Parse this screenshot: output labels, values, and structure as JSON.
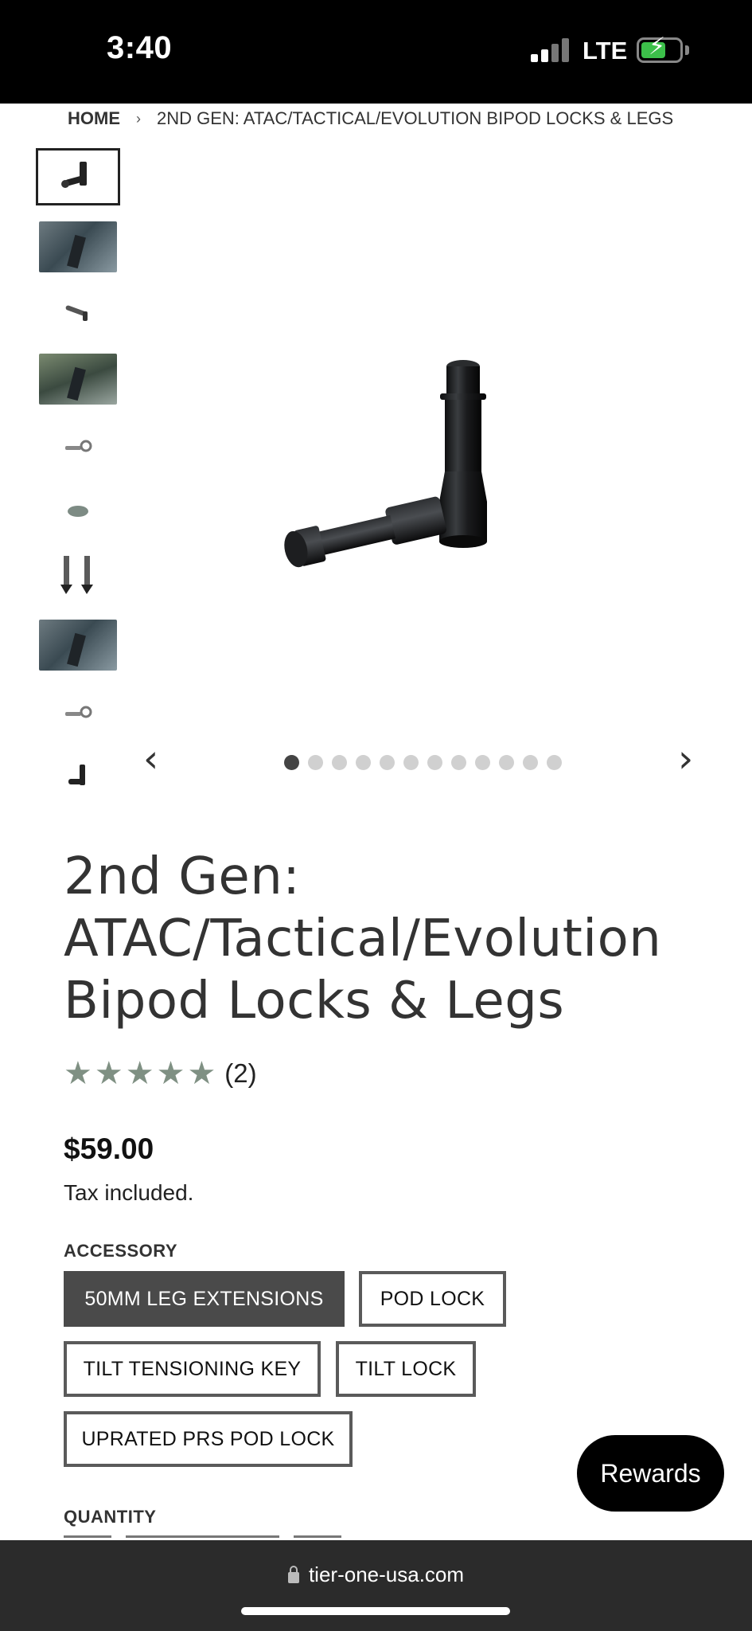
{
  "status_bar": {
    "time": "3:40",
    "network": "LTE",
    "icons": [
      "signal-icon",
      "battery-charging-icon"
    ]
  },
  "breadcrumb": {
    "home": "HOME",
    "separator": "›",
    "current": "2ND GEN: ATAC/TACTICAL/EVOLUTION BIPOD LOCKS & LEGS"
  },
  "gallery": {
    "thumbnail_count": 10,
    "active_index": 0,
    "dots_count": 12,
    "active_dot": 0,
    "prev_icon": "chevron-left-icon",
    "next_icon": "chevron-right-icon",
    "prev_glyph": "‹",
    "next_glyph": "›"
  },
  "product": {
    "title": "2nd Gen: ATAC/Tactical/Evolution Bipod Locks & Legs",
    "rating": {
      "stars": 5,
      "max": 5,
      "review_count": "(2)",
      "star_glyph": "★"
    },
    "price": "$59.00",
    "tax_note": "Tax included."
  },
  "options": {
    "label": "ACCESSORY",
    "items": [
      {
        "label": "50MM LEG EXTENSIONS",
        "selected": true
      },
      {
        "label": "POD LOCK",
        "selected": false
      },
      {
        "label": "TILT TENSIONING KEY",
        "selected": false
      },
      {
        "label": "TILT LOCK",
        "selected": false
      },
      {
        "label": "UPRATED PRS POD LOCK",
        "selected": false
      }
    ]
  },
  "quantity": {
    "label": "QUANTITY"
  },
  "rewards": {
    "label": "Rewards"
  },
  "browser": {
    "url": "tier-one-usa.com"
  },
  "colors": {
    "star": "#7f9083",
    "selected_option_bg": "#4a4a4a",
    "status_bar_bg": "#000000",
    "browser_bar_bg": "#2b2b2b",
    "battery_fill": "#3cc04a"
  }
}
